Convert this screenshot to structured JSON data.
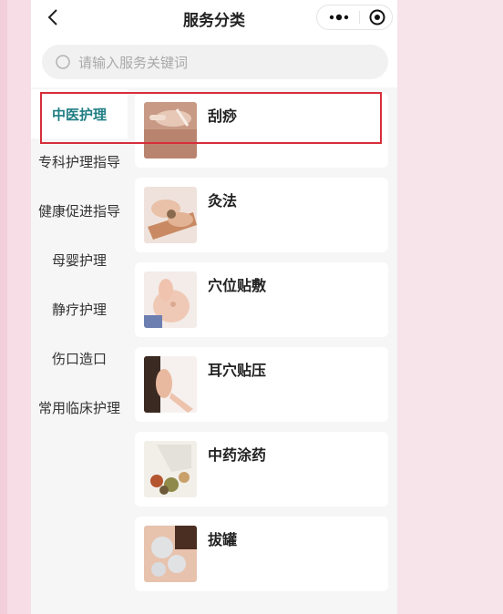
{
  "nav": {
    "title": "服务分类",
    "back_icon": "chevron-left-icon",
    "more_icon": "more-dots-icon",
    "target_icon": "target-circle-icon"
  },
  "search": {
    "placeholder": "请输入服务关键词",
    "icon": "search-icon"
  },
  "sidebar": {
    "items": [
      {
        "label": "中医护理",
        "active": true
      },
      {
        "label": "专科护理指导"
      },
      {
        "label": "健康促进指导"
      },
      {
        "label": "母婴护理"
      },
      {
        "label": "静疗护理"
      },
      {
        "label": "伤口造口"
      },
      {
        "label": "常用临床护理"
      }
    ]
  },
  "services": [
    {
      "title": "刮痧"
    },
    {
      "title": "灸法"
    },
    {
      "title": "穴位贴敷"
    },
    {
      "title": "耳穴贴压"
    },
    {
      "title": "中药涂药"
    },
    {
      "title": "拔罐"
    }
  ],
  "colors": {
    "accent": "#1f7d84",
    "highlight_box": "#d62e3a",
    "background_pink": "#f6dde6"
  }
}
